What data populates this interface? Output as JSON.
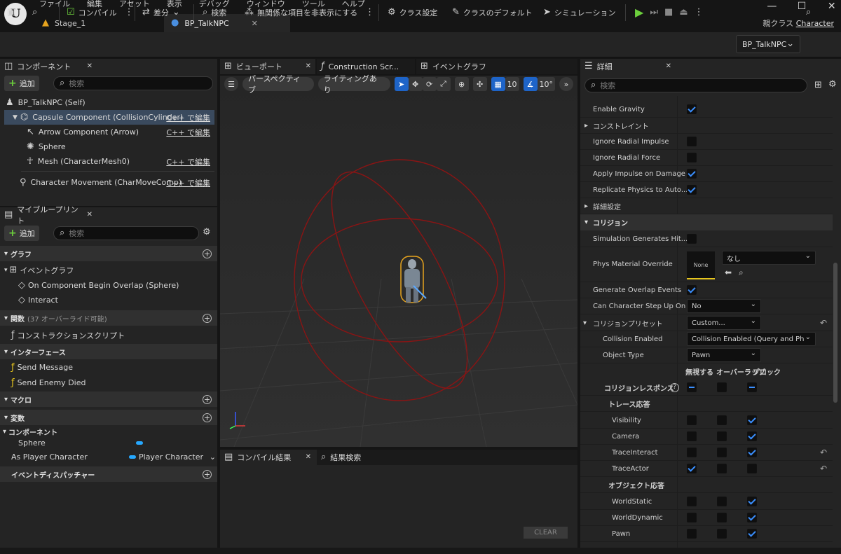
{
  "menubar": {
    "items": [
      "ファイル",
      "編集",
      "アセット",
      "表示",
      "デバッグ",
      "ウィンドウ",
      "ツール",
      "ヘルプ"
    ],
    "parent_class_label": "親クラス",
    "parent_class_value": "Character"
  },
  "doc_tabs": [
    {
      "label": "Stage_1"
    },
    {
      "label": "BP_TalkNPC"
    }
  ],
  "toolbar": {
    "compile": "コンパイル",
    "diff": "差分",
    "search": "検索",
    "hide_unrelated": "無関係な項目を非表示にする",
    "class_settings": "クラス設定",
    "class_defaults": "クラスのデフォルト",
    "simulation": "シミュレーション",
    "debug_object": "BP_TalkNPC"
  },
  "components_panel": {
    "tab": "コンポーネント",
    "add": "追加",
    "search_placeholder": "検索",
    "root": "BP_TalkNPC (Self)",
    "items": [
      {
        "label": "Capsule Component (CollisionCylinder)",
        "link": "C++ で編集"
      },
      {
        "label": "Arrow Component (Arrow)",
        "link": "C++ で編集"
      },
      {
        "label": "Sphere",
        "link": ""
      },
      {
        "label": "Mesh (CharacterMesh0)",
        "link": "C++ で編集"
      },
      {
        "label": "Character Movement (CharMoveComp)",
        "link": "C++ で編集"
      }
    ]
  },
  "myblueprint": {
    "tab": "マイブループリント",
    "add": "追加",
    "search_placeholder": "検索",
    "graph": "グラフ",
    "event_graph": "イベントグラフ",
    "events": [
      "On Component Begin Overlap (Sphere)",
      "Interact"
    ],
    "functions": "関数",
    "functions_count": "(37 オーバーライド可能)",
    "construction_script": "コンストラクションスクリプト",
    "interfaces": "インターフェース",
    "interface_items": [
      "Send Message",
      "Send Enemy Died"
    ],
    "macros": "マクロ",
    "variables": "変数",
    "components_cat": "コンポーネント",
    "var_sphere": "Sphere",
    "var_player_label": "As Player Character",
    "var_player_type": "Player Character",
    "dispatchers": "イベントディスパッチャー"
  },
  "viewport": {
    "tabs": [
      {
        "label": "ビューポート"
      },
      {
        "label": "Construction Scr..."
      },
      {
        "label": "イベントグラフ"
      }
    ],
    "perspective": "パースペクティブ",
    "lighting": "ライティングあり",
    "grid_size": "10",
    "angle": "10°"
  },
  "bottom_panel": {
    "tab_compile": "コンパイル結果",
    "tab_find": "結果検索",
    "clear": "CLEAR"
  },
  "details": {
    "tab": "詳細",
    "search_placeholder": "検索",
    "rows": {
      "enable_gravity": "Enable Gravity",
      "constraints": "コンストレイント",
      "ignore_radial_impulse": "Ignore Radial Impulse",
      "ignore_radial_force": "Ignore Radial Force",
      "apply_impulse": "Apply Impulse on Damage",
      "replicate_physics": "Replicate Physics to Auto...",
      "advanced": "詳細設定",
      "collision": "コリジョン",
      "sim_gen_hit": "Simulation Generates Hit...",
      "phys_material": "Phys Material Override",
      "phys_material_thumb": "None",
      "phys_material_value": "なし",
      "gen_overlap": "Generate Overlap Events",
      "step_up": "Can Character Step Up On",
      "step_up_value": "No",
      "preset": "コリジョンプリセット",
      "preset_value": "Custom...",
      "collision_enabled": "Collision Enabled",
      "collision_enabled_value": "Collision Enabled (Query and Physics)",
      "object_type": "Object Type",
      "object_type_value": "Pawn",
      "col_ignore": "無視する",
      "col_overlap": "オーバーラップ",
      "col_block": "ブロック",
      "responses": "コリジョンレスポンス",
      "trace_resp": "トレース応答",
      "visibility": "Visibility",
      "camera": "Camera",
      "trace_interact": "TraceInteract",
      "trace_actor": "TraceActor",
      "object_resp": "オブジェクト応答",
      "world_static": "WorldStatic",
      "world_dynamic": "WorldDynamic",
      "pawn": "Pawn"
    }
  },
  "colors": {
    "accent_blue": "#1e64c8",
    "green": "#6ccf3c",
    "red_lines": "#8a1414",
    "capsule": "#e6a31e"
  }
}
